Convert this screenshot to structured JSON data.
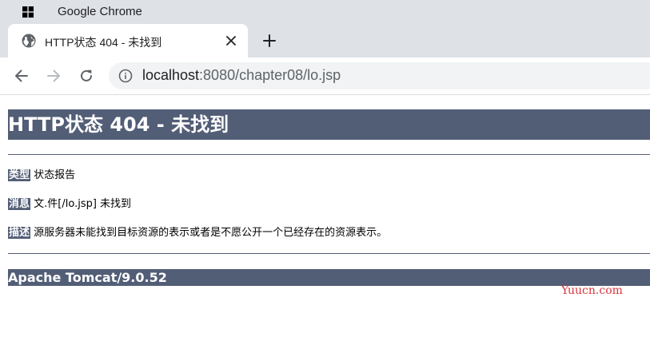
{
  "window": {
    "title": "Google Chrome"
  },
  "tab": {
    "title": "HTTP状态 404 - 未找到"
  },
  "address_bar": {
    "url_host": "localhost",
    "url_path": ":8080/chapter08/lo.jsp"
  },
  "page": {
    "heading": "HTTP状态 404 - 未找到",
    "type_label": "类型",
    "type_value": "状态报告",
    "message_label": "消息",
    "message_value": "文.件[/lo.jsp] 未找到",
    "description_label": "描述",
    "description_value": "源服务器未能找到目标资源的表示或者是不愿公开一个已经存在的资源表示。",
    "footer": "Apache Tomcat/9.0.52"
  },
  "watermark": {
    "text": "Yuucn.com"
  },
  "icons": {
    "windows_logo": "windows-logo-icon",
    "favicon": "globe-icon",
    "tab_close": "close-icon",
    "new_tab": "plus-icon",
    "back": "arrow-left-icon",
    "forward": "arrow-right-icon",
    "reload": "reload-icon",
    "site_info": "info-icon"
  },
  "colors": {
    "tomcat_bar": "#525d76",
    "chrome_frame": "#dee1e6",
    "omnibox": "#f1f3f4",
    "watermark": "#d9363e"
  }
}
